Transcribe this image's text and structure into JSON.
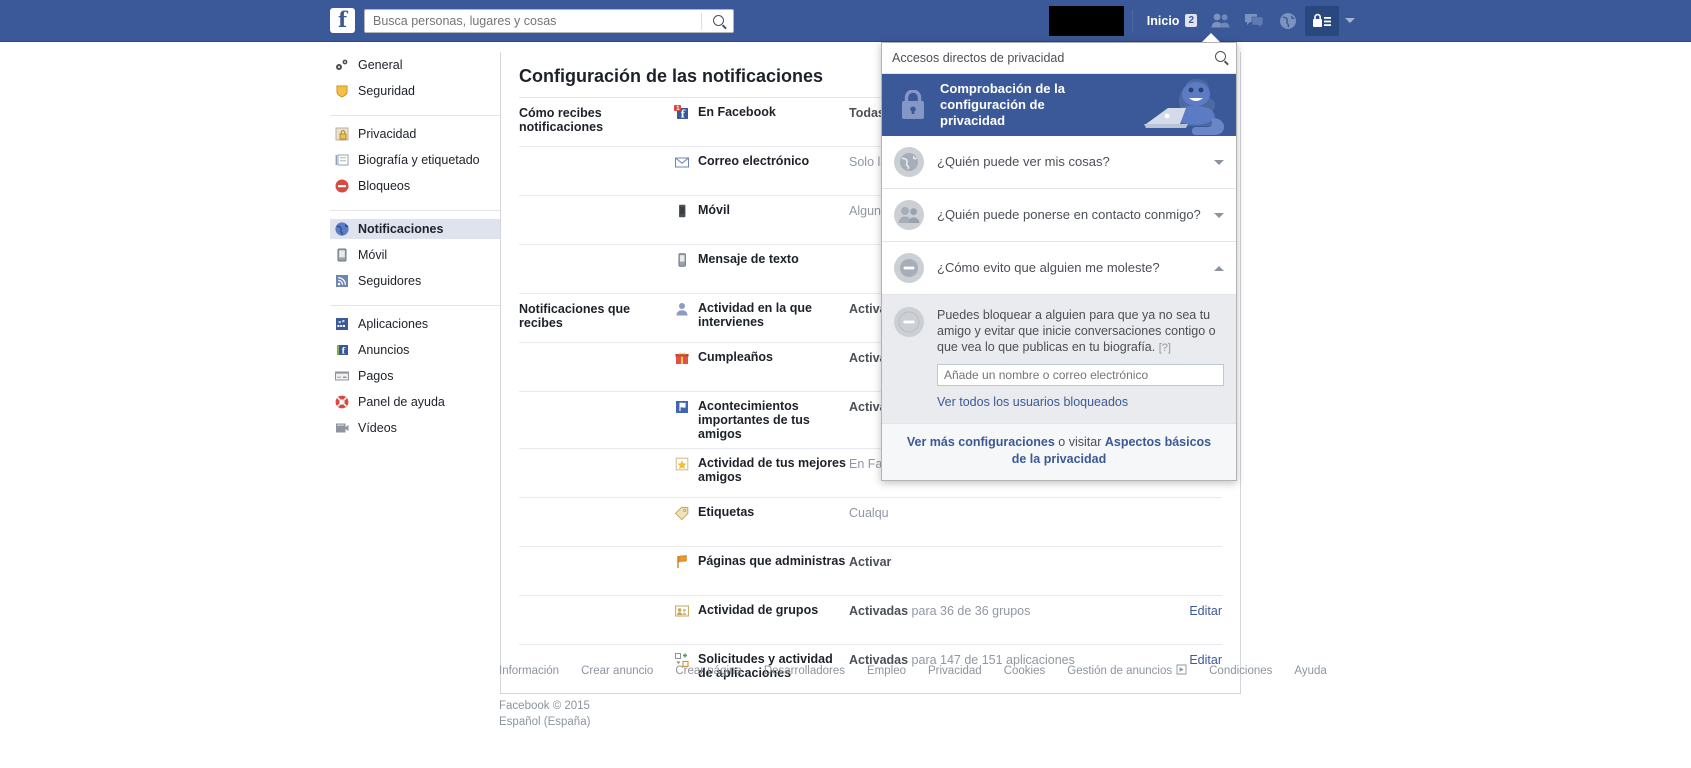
{
  "topbar": {
    "logo": "f",
    "search_placeholder": "Busca personas, lugares y cosas",
    "search_value": "",
    "search_icon": "search-icon",
    "home_label": "Inicio",
    "home_badge": "2",
    "icons": [
      "friend-requests-icon",
      "messages-icon",
      "notifications-globe-icon",
      "privacy-lock-icon",
      "account-caret-icon"
    ]
  },
  "sidebar": {
    "groups": [
      {
        "items": [
          {
            "label": "General",
            "icon": "gears-icon",
            "selected": false
          },
          {
            "label": "Seguridad",
            "icon": "shield-icon",
            "selected": false
          }
        ]
      },
      {
        "items": [
          {
            "label": "Privacidad",
            "icon": "lock-icon",
            "selected": false
          },
          {
            "label": "Biografía y etiquetado",
            "icon": "timeline-icon",
            "selected": false
          },
          {
            "label": "Bloqueos",
            "icon": "block-icon",
            "selected": false
          }
        ]
      },
      {
        "items": [
          {
            "label": "Notificaciones",
            "icon": "globe-icon",
            "selected": true
          },
          {
            "label": "Móvil",
            "icon": "mobile-icon",
            "selected": false
          },
          {
            "label": "Seguidores",
            "icon": "rss-icon",
            "selected": false
          }
        ]
      },
      {
        "items": [
          {
            "label": "Aplicaciones",
            "icon": "apps-icon",
            "selected": false
          },
          {
            "label": "Anuncios",
            "icon": "ads-icon",
            "selected": false
          },
          {
            "label": "Pagos",
            "icon": "payments-icon",
            "selected": false
          },
          {
            "label": "Panel de ayuda",
            "icon": "lifebuoy-icon",
            "selected": false
          },
          {
            "label": "Vídeos",
            "icon": "video-icon",
            "selected": false
          }
        ]
      }
    ]
  },
  "main": {
    "title": "Configuración de las notificaciones",
    "sections": [
      {
        "section_label": "Cómo recibes notificaciones",
        "rows": [
          {
            "icon": "facebook-badge-icon",
            "label": "En Facebook",
            "value_strong": "Todas",
            "value_rest": "",
            "edit": ""
          },
          {
            "icon": "envelope-icon",
            "label": "Correo electrónico",
            "value_strong": "",
            "value_rest": "Solo las",
            "edit": ""
          },
          {
            "icon": "phone-icon",
            "label": "Móvil",
            "value_strong": "",
            "value_rest": "Algunas",
            "edit": ""
          },
          {
            "icon": "sms-icon",
            "label": "Mensaje de texto",
            "value_strong": "",
            "value_rest": "",
            "edit": ""
          }
        ]
      },
      {
        "section_label": "Notificaciones que recibes",
        "rows": [
          {
            "icon": "person-icon",
            "label": "Actividad en la que intervienes",
            "value_strong": "Activa",
            "value_rest": "",
            "edit": ""
          },
          {
            "icon": "gift-icon",
            "label": "Cumpleaños",
            "value_strong": "Activa",
            "value_rest": "",
            "edit": ""
          },
          {
            "icon": "flag-blue-icon",
            "label": "Acontecimientos importantes de tus amigos",
            "value_strong": "Activa",
            "value_rest": "",
            "edit": ""
          },
          {
            "icon": "star-icon",
            "label": "Actividad de tus mejores amigos",
            "value_strong": "",
            "value_rest": "En Fac",
            "edit": ""
          },
          {
            "icon": "tag-icon",
            "label": "Etiquetas",
            "value_strong": "",
            "value_rest": "Cualqu",
            "edit": ""
          },
          {
            "icon": "flag-orange-icon",
            "label": "Páginas que administras",
            "value_strong": "Activar",
            "value_rest": "",
            "edit": ""
          },
          {
            "icon": "group-icon",
            "label": "Actividad de grupos",
            "value_strong": "Activadas",
            "value_rest": " para 36 de 36 grupos",
            "edit": "Editar"
          },
          {
            "icon": "app-request-icon",
            "label": "Solicitudes y actividad de aplicaciones",
            "value_strong": "Activadas",
            "value_rest": " para 147 de 151 aplicaciones",
            "edit": "Editar"
          }
        ]
      }
    ]
  },
  "popup": {
    "header_title": "Accesos directos de privacidad",
    "header_search_icon": "search-icon",
    "banner": {
      "icon": "lock-icon",
      "title": "Comprobación de la configuración de privacidad",
      "mascot": "dinosaur-mascot-icon"
    },
    "rows": [
      {
        "icon": "globe-icon",
        "label": "¿Quién puede ver mis cosas?",
        "expanded": false
      },
      {
        "icon": "people-icon",
        "label": "¿Quién puede ponerse en contacto conmigo?",
        "expanded": false
      },
      {
        "icon": "block-icon",
        "label": "¿Cómo evito que alguien me moleste?",
        "expanded": true
      }
    ],
    "expanded": {
      "icon": "block-icon",
      "description": "Puedes bloquear a alguien para que ya no sea tu amigo y evitar que inicie conversaciones contigo o que vea lo que publicas en tu biografía.",
      "help_hint": "[?]",
      "input_placeholder": "Añade un nombre o correo electrónico",
      "input_value": "",
      "blocked_link": "Ver todos los usuarios bloqueados"
    },
    "footer": {
      "link1": "Ver más configuraciones",
      "middle": " o visitar ",
      "link2": "Aspectos básicos de la privacidad"
    }
  },
  "footer": {
    "links": [
      "Información",
      "Crear anuncio",
      "Crear página",
      "Desarrolladores",
      "Empleo",
      "Privacidad",
      "Cookies",
      "Gestión de anuncios",
      "Condiciones",
      "Ayuda"
    ],
    "ads_icon": "triangle-play-icon",
    "copyright": "Facebook © 2015",
    "language": "Español (España)"
  },
  "colors": {
    "brand_blue": "#3b5998",
    "dark_blue": "#29487d",
    "selected_bg": "#dfe3ee",
    "muted_text": "#9197a3",
    "expand_bg": "#e9ebee"
  }
}
